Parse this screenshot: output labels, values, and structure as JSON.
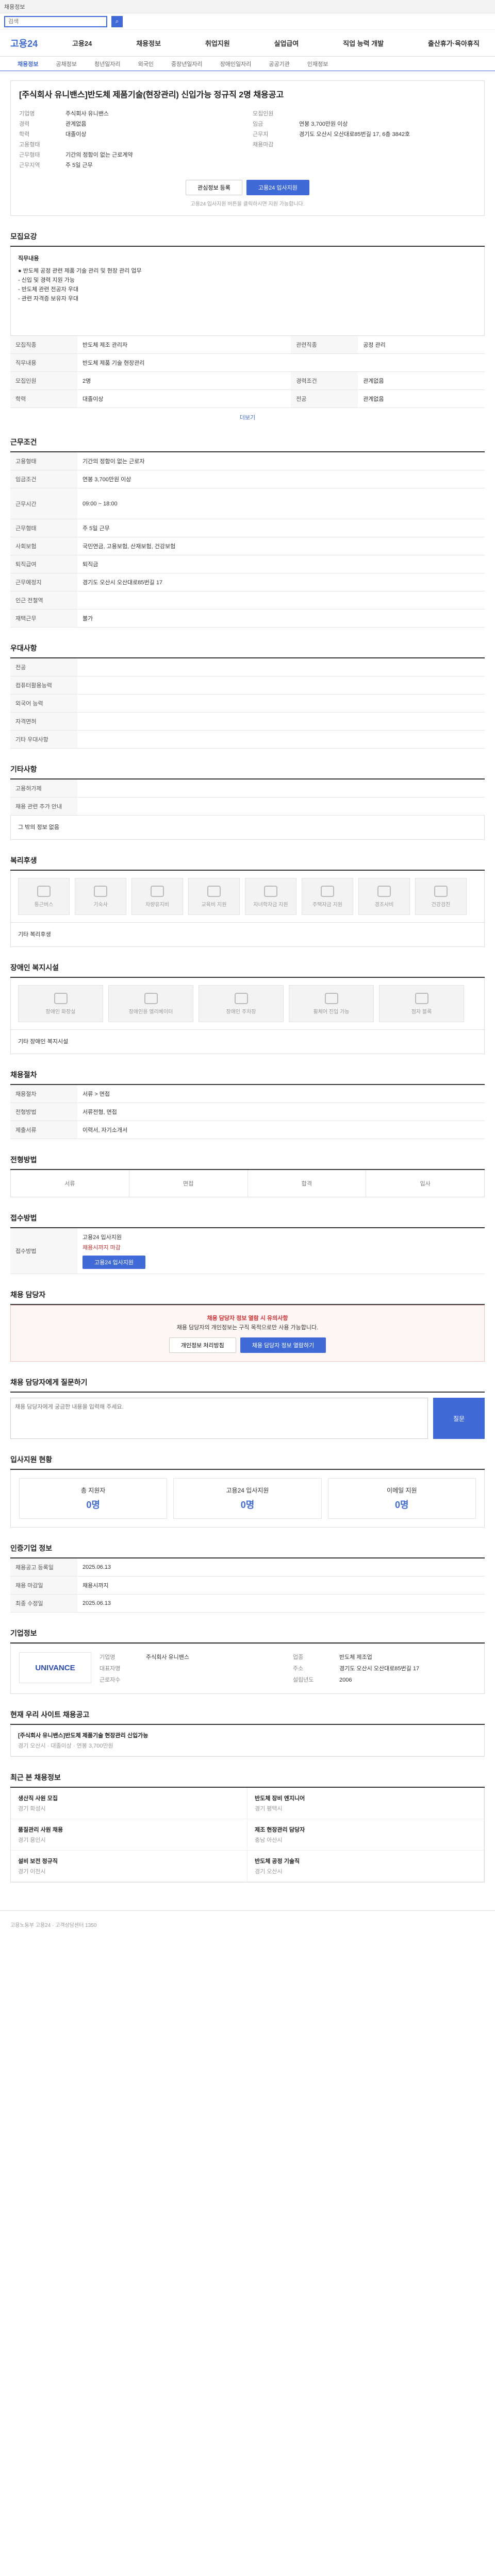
{
  "top": {
    "text": "채용정보"
  },
  "search": {
    "placeholder": "검색"
  },
  "brand": {
    "logo": "고용24"
  },
  "gnb": [
    "고용24",
    "채용정보",
    "취업지원",
    "실업급여",
    "직업 능력 개발",
    "출산휴가·육아휴직"
  ],
  "subnav": [
    "채용정보",
    "공채정보",
    "청년일자리",
    "외국인",
    "중장년일자리",
    "장애인일자리",
    "공공기관",
    "인재정보"
  ],
  "job": {
    "title": "[주식회사 유니밴스]반도체 제품기술(현장관리) 신입가능 정규직 2명 채용공고",
    "left": [
      {
        "k": "기업명",
        "v": "주식회사 유니밴스"
      },
      {
        "k": "경력",
        "v": "관계없음"
      },
      {
        "k": "학력",
        "v": "대졸이상"
      },
      {
        "k": "고용형태",
        "v": ""
      },
      {
        "k": "근무형태",
        "v": "기간의 정함이 없는 근로계약"
      },
      {
        "k": "근무지역",
        "v": "주 5일 근무"
      }
    ],
    "right": [
      {
        "k": "모집인원",
        "v": ""
      },
      {
        "k": "임금",
        "v": "연봉 3,700만원 이상"
      },
      {
        "k": "근무지",
        "v": "경기도 오산시 오산대로85번길 17, 6층 3842호"
      },
      {
        "k": "채용마감",
        "v": ""
      }
    ],
    "btn_save": "관심정보 등록",
    "btn_apply": "고용24 입사지원",
    "note": "고용24 입사지원 버튼을 클릭하시면 지원 가능합니다."
  },
  "sections": {
    "recruit": "모집요강",
    "condition": "근무조건",
    "welfare": "우대사항",
    "other": "기타사항",
    "benefit": "복리후생",
    "disabled": "장애인 복지시설",
    "process": "채용절차",
    "method": "전형방법",
    "apply": "접수방법",
    "contact": "채용 담당자",
    "qa": "채용 담당자에게 질문하기",
    "stats": "입사지원 현황",
    "period": "인증기업 정보",
    "company": "기업정보",
    "related": "현재 우리 사이트 채용공고",
    "recent": "최근 본 채용정보"
  },
  "recruit": {
    "lead": "직무내용",
    "body": "● 반도체 공정 관련 제품 기술 관리 및 현장 관리 업무\n- 신입 및 경력 지원 가능\n- 반도체 관련 전공자 우대\n- 관련 자격증 보유자 우대",
    "rows": [
      {
        "k": "모집직종",
        "v": "반도체 제조 관리자"
      },
      {
        "k": "관련직종",
        "v": "공정 관리"
      },
      {
        "k": "직무내용",
        "v": "반도체 제품 기술 현장관리"
      },
      {
        "k": "모집인원",
        "v": "2명"
      },
      {
        "k": "경력조건",
        "v": "관계없음"
      },
      {
        "k": "학력",
        "v": "대졸이상"
      },
      {
        "k": "전공",
        "v": "관계없음"
      }
    ],
    "more": "더보기"
  },
  "condition": {
    "rows": [
      {
        "k": "고용형태",
        "v": "기간의 정함이 없는 근로자"
      },
      {
        "k": "임금조건",
        "v": "연봉 3,700만원 이상"
      },
      {
        "k": "근무시간",
        "v": "09:00 ~ 18:00"
      },
      {
        "k": "근무형태",
        "v": "주 5일 근무"
      },
      {
        "k": "사회보험",
        "v": "국민연금, 고용보험, 산재보험, 건강보험"
      },
      {
        "k": "퇴직급여",
        "v": "퇴직금"
      },
      {
        "k": "근무예정지",
        "v": "경기도 오산시 오산대로85번길 17"
      },
      {
        "k": "인근 전철역",
        "v": ""
      },
      {
        "k": "재택근무",
        "v": "불가"
      }
    ]
  },
  "welfare": {
    "rows": [
      {
        "k": "전공",
        "v": ""
      },
      {
        "k": "컴퓨터활용능력",
        "v": ""
      },
      {
        "k": "외국어 능력",
        "v": ""
      },
      {
        "k": "자격면허",
        "v": ""
      },
      {
        "k": "기타 우대사항",
        "v": ""
      }
    ]
  },
  "other": {
    "rows": [
      {
        "k": "고용허가제",
        "v": ""
      },
      {
        "k": "채용 관련 추가 안내",
        "v": ""
      }
    ],
    "note": "그 밖의 정보 없음"
  },
  "benefit": {
    "items": [
      "통근버스",
      "기숙사",
      "차량유지비",
      "교육비 지원",
      "자녀학자금 지원",
      "주택자금 지원",
      "경조사비",
      "건강검진"
    ],
    "note": "기타 복리후생"
  },
  "disabled": {
    "items": [
      "장애인 화장실",
      "장애인용 엘리베이터",
      "장애인 주차장",
      "휠체어 진입 가능",
      "점자 블록"
    ],
    "note": "기타 장애인 복지시설"
  },
  "process": {
    "rows": [
      {
        "k": "채용절차",
        "v": "서류 > 면접"
      },
      {
        "k": "전형방법",
        "v": "서류전형, 면접"
      },
      {
        "k": "제출서류",
        "v": "이력서, 자기소개서"
      }
    ]
  },
  "method": {
    "steps": [
      "서류",
      "면접",
      "합격",
      "입사"
    ]
  },
  "apply": {
    "k": "접수방법",
    "v": "고용24 입사지원",
    "deadline": "채용시까지 마감",
    "btn": "고용24 입사지원"
  },
  "contact": {
    "text": "채용 담당자 정보 열람 시 유의사항",
    "body": "채용 담당자의 개인정보는 구직 목적으로만 사용 가능합니다.",
    "btn1": "개인정보 처리방침",
    "btn2": "채용 담당자 정보 열람하기"
  },
  "qa": {
    "placeholder": "채용 담당자에게 궁금한 내용을 입력해 주세요.",
    "btn": "질문"
  },
  "stats": {
    "cards": [
      {
        "label": "총 지원자",
        "n": "0명"
      },
      {
        "label": "고용24 입사지원",
        "n": "0명"
      },
      {
        "label": "이메일 지원",
        "n": "0명"
      }
    ]
  },
  "period": {
    "rows": [
      {
        "k": "채용공고 등록일",
        "v": "2025.06.13"
      },
      {
        "k": "채용 마감일",
        "v": "채용시까지"
      },
      {
        "k": "최종 수정일",
        "v": "2025.06.13"
      }
    ]
  },
  "company": {
    "logo": "UNIVANCE",
    "rows": [
      {
        "k": "기업명",
        "v": "주식회사 유니밴스"
      },
      {
        "k": "업종",
        "v": "반도체 제조업"
      },
      {
        "k": "대표자명",
        "v": ""
      },
      {
        "k": "주소",
        "v": "경기도 오산시 오산대로85번길 17"
      },
      {
        "k": "근로자수",
        "v": ""
      },
      {
        "k": "설립년도",
        "v": "2006"
      }
    ]
  },
  "related": {
    "items": [
      {
        "t": "[주식회사 유니밴스]반도체 제품기술 현장관리 신입가능",
        "d": "경기 오산시 · 대졸이상 · 연봉 3,700만원"
      }
    ]
  },
  "recent": {
    "items": [
      {
        "t": "생산직 사원 모집",
        "d": "경기 화성시"
      },
      {
        "t": "반도체 장비 엔지니어",
        "d": "경기 평택시"
      },
      {
        "t": "품질관리 사원 채용",
        "d": "경기 용인시"
      },
      {
        "t": "제조 현장관리 담당자",
        "d": "충남 아산시"
      },
      {
        "t": "설비 보전 정규직",
        "d": "경기 이천시"
      },
      {
        "t": "반도체 공정 기술직",
        "d": "경기 오산시"
      }
    ]
  },
  "footer": {
    "text": "고용노동부 고용24 · 고객상담센터 1350"
  }
}
